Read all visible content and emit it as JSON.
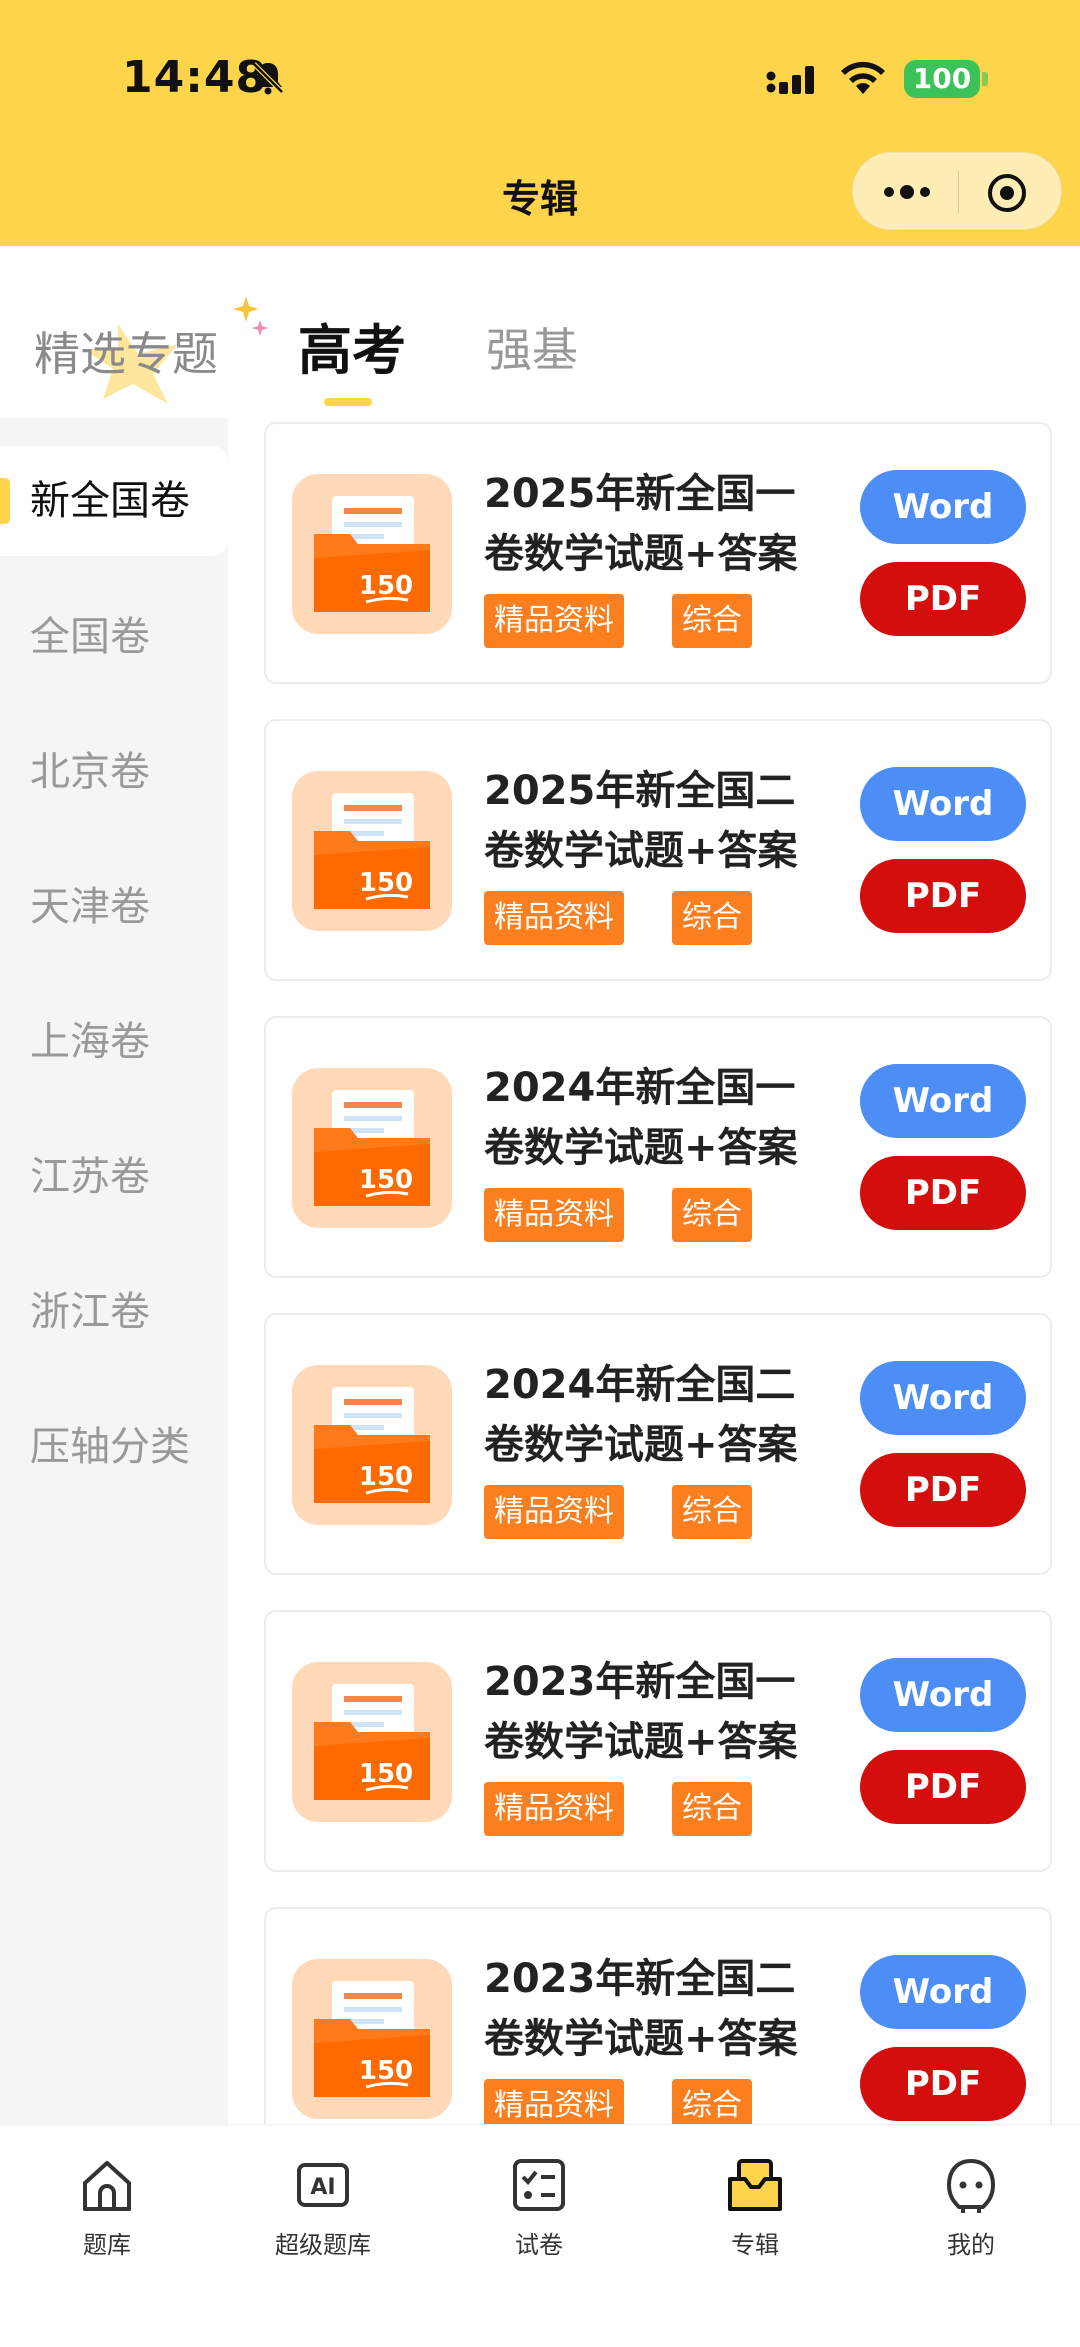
{
  "status_bar": {
    "time": "14:48",
    "battery": "100"
  },
  "nav": {
    "title": "专辑"
  },
  "tabs": [
    {
      "label": "精选专题"
    },
    {
      "label": "高考"
    },
    {
      "label": "强基"
    }
  ],
  "sidebar": {
    "items": [
      {
        "label": "新全国卷"
      },
      {
        "label": "全国卷"
      },
      {
        "label": "北京卷"
      },
      {
        "label": "天津卷"
      },
      {
        "label": "上海卷"
      },
      {
        "label": "江苏卷"
      },
      {
        "label": "浙江卷"
      },
      {
        "label": "压轴分类"
      }
    ]
  },
  "cards": [
    {
      "title": "2025年新全国一卷数学试题+答案",
      "tag1": "精品资料",
      "tag2": "综合",
      "word": "Word",
      "pdf": "PDF",
      "icon_number": "150"
    },
    {
      "title": "2025年新全国二卷数学试题+答案",
      "tag1": "精品资料",
      "tag2": "综合",
      "word": "Word",
      "pdf": "PDF",
      "icon_number": "150"
    },
    {
      "title": "2024年新全国一卷数学试题+答案",
      "tag1": "精品资料",
      "tag2": "综合",
      "word": "Word",
      "pdf": "PDF",
      "icon_number": "150"
    },
    {
      "title": "2024年新全国二卷数学试题+答案",
      "tag1": "精品资料",
      "tag2": "综合",
      "word": "Word",
      "pdf": "PDF",
      "icon_number": "150"
    },
    {
      "title": "2023年新全国一卷数学试题+答案",
      "tag1": "精品资料",
      "tag2": "综合",
      "word": "Word",
      "pdf": "PDF",
      "icon_number": "150"
    },
    {
      "title": "2023年新全国二卷数学试题+答案",
      "tag1": "精品资料",
      "tag2": "综合",
      "word": "Word",
      "pdf": "PDF",
      "icon_number": "150"
    }
  ],
  "bottom_nav": [
    {
      "label": "题库",
      "icon": "home-icon"
    },
    {
      "label": "超级题库",
      "icon": "ai-icon"
    },
    {
      "label": "试卷",
      "icon": "checklist-icon"
    },
    {
      "label": "专辑",
      "icon": "album-icon"
    },
    {
      "label": "我的",
      "icon": "profile-icon"
    }
  ],
  "colors": {
    "header": "#fdd44a",
    "word_button": "#4c8df6",
    "pdf_button": "#d40d0d",
    "tag": "#fb7e1f"
  }
}
